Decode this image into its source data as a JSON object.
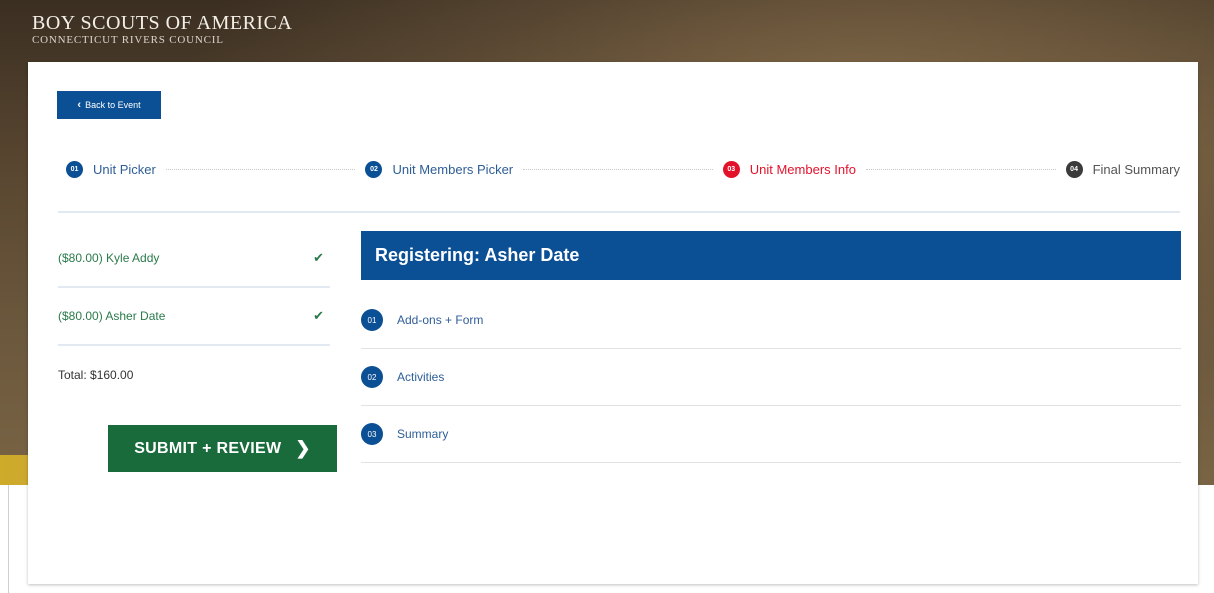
{
  "brand": {
    "title": "BOY SCOUTS OF AMERICA",
    "subtitle": "CONNECTICUT RIVERS COUNCIL"
  },
  "back_button": {
    "label": "Back to Event",
    "icon": "chevron-left-icon"
  },
  "progress_steps": [
    {
      "number": "01",
      "label": "Unit Picker",
      "state": "complete",
      "color": "#0b4f94"
    },
    {
      "number": "02",
      "label": "Unit Members Picker",
      "state": "complete",
      "color": "#0b4f94"
    },
    {
      "number": "03",
      "label": "Unit Members Info",
      "state": "current",
      "color": "#e3122b"
    },
    {
      "number": "04",
      "label": "Final Summary",
      "state": "upcoming",
      "color": "#3b3b3b"
    }
  ],
  "members": [
    {
      "label": "($80.00) Kyle Addy",
      "icon": "check-icon"
    },
    {
      "label": "($80.00) Asher Date",
      "icon": "check-icon"
    }
  ],
  "total": "Total: $160.00",
  "submit_button": {
    "label": "SUBMIT + REVIEW",
    "icon": "chevron-right-icon"
  },
  "registering": {
    "title": "Registering: Asher Date"
  },
  "substeps": [
    {
      "number": "01",
      "label": "Add-ons + Form"
    },
    {
      "number": "02",
      "label": "Activities"
    },
    {
      "number": "03",
      "label": "Summary"
    }
  ],
  "colors": {
    "primary_blue": "#0b4f94",
    "accent_red": "#e3122b",
    "success_green": "#2a7a4a",
    "button_green": "#1a6b3c"
  }
}
